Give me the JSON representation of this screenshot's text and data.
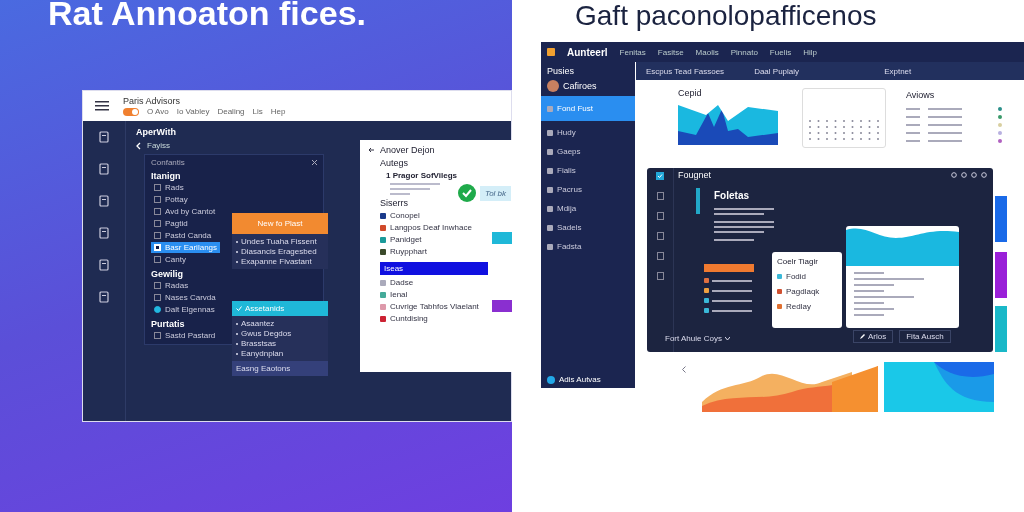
{
  "left_headline": "Rat Annoaton fices.",
  "right_headline": "Gaft paconolopafficenos",
  "left_app": {
    "title": "Paris Advisors",
    "toggle_on": true,
    "menu": [
      "O Avo",
      "Io Vabley",
      "Dealing",
      "Lis",
      "Hep"
    ],
    "section_title": "AperWith",
    "back_label": "Fayiss",
    "panel": {
      "title": "Confantis",
      "groups": [
        {
          "heading": "Itanign",
          "items": [
            {
              "label": "Rads",
              "kind": "checkbox",
              "checked": false,
              "selected": false
            },
            {
              "label": "Pottay",
              "kind": "checkbox",
              "checked": false,
              "selected": false
            },
            {
              "label": "Avd by Cantot",
              "kind": "checkbox",
              "checked": false,
              "selected": false
            },
            {
              "label": "Pagtid",
              "kind": "checkbox",
              "checked": false,
              "selected": false
            },
            {
              "label": "Pastd Canda",
              "kind": "checkbox",
              "checked": false,
              "selected": false
            },
            {
              "label": "Basr Earilangs",
              "kind": "checkbox",
              "checked": true,
              "selected": true
            },
            {
              "label": "Canty",
              "kind": "checkbox",
              "checked": false,
              "selected": false
            }
          ]
        },
        {
          "heading": "Gewilig",
          "items": [
            {
              "label": "Radas",
              "kind": "checkbox",
              "checked": false,
              "selected": false
            },
            {
              "label": "Nases Carvda",
              "kind": "checkbox",
              "checked": false,
              "selected": false
            },
            {
              "label": "Dalt Elgennas",
              "kind": "radio",
              "checked": true,
              "selected": false
            }
          ]
        },
        {
          "heading": "Purtatis",
          "items": [
            {
              "label": "Sastd Pastard",
              "kind": "checkbox",
              "checked": false,
              "selected": false
            }
          ]
        }
      ]
    },
    "orange_card": {
      "title": "New fo Plast",
      "bullets": [
        "Undes Tuaha Fissent",
        "Diasancis Eragesbed",
        "Exapanne Fivastant"
      ]
    },
    "cyan_card": {
      "title": "Assetanids",
      "items": [
        "Asaantez",
        "Gwus Degdos",
        "Brasstsas",
        "Eanydnplan"
      ],
      "footer": "Easng Eaotons"
    },
    "doc": {
      "title": "Anover Dejon",
      "heading": "Autegs",
      "step": "1 Pragor SofVilegs",
      "bubble": "Tol bk",
      "subheading": "Siserrs",
      "items": [
        "Conopel",
        "Langpos Deaf Inwhace",
        "Panidget",
        "Ruypphart"
      ],
      "blue_bar": "Iseas",
      "blue_items": [
        "Dadse",
        "Ienal",
        "Cuvrige Tabhfos Vlaelant",
        "Cuntdising"
      ]
    }
  },
  "right_app": {
    "brand": "Aunteerl",
    "menu": [
      "Fenitas",
      "Fasitse",
      "Maolis",
      "Pinnato",
      "Fuelis",
      "Hilp"
    ],
    "sidebar": {
      "title": "Pusies",
      "user": "Cafiroes",
      "items": [
        {
          "label": "Fond Fust",
          "selected": true
        },
        {
          "label": "Hudy",
          "selected": false
        },
        {
          "label": "Gaeps",
          "selected": false
        },
        {
          "label": "Fialis",
          "selected": false
        },
        {
          "label": "Pacrus",
          "selected": false
        },
        {
          "label": "Mdija",
          "selected": false
        },
        {
          "label": "Sadels",
          "selected": false
        },
        {
          "label": "Fadsta",
          "selected": false
        }
      ],
      "footer": "Adis Autvas"
    },
    "subbar": {
      "title": "Escpus Tead Fassoes",
      "search": {
        "placeholder": "Daal Puplaiy"
      },
      "export": "Exptnet"
    },
    "chart_card": {
      "title": "Cepid"
    },
    "legend": {
      "title": "Aviows",
      "items": [
        {
          "color": "#2a8f8a"
        },
        {
          "color": "#3a9a6a"
        },
        {
          "color": "#d8cfa0"
        },
        {
          "color": "#b8b0e0"
        },
        {
          "color": "#b060c0"
        }
      ]
    },
    "modal": {
      "title": "Fougnet",
      "heading": "Foletas",
      "card": {
        "title": "Coelr Tiagir",
        "items": [
          "Fodid",
          "Pagdlaqk",
          "Redlay"
        ]
      },
      "buttons": [
        "Arlos",
        "Fita Ausch"
      ],
      "footer": "Fort Ahuie Coys"
    }
  }
}
